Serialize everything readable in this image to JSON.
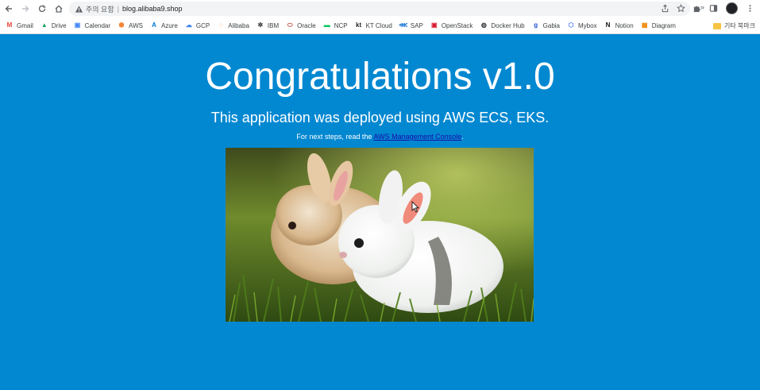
{
  "browser": {
    "security_label": "주의 요함",
    "url": "blog.alibaba9.shop"
  },
  "bookmarks": [
    {
      "label": "Gmail",
      "icon": "gmail-icon",
      "color": "#ea4335",
      "glyph": "M"
    },
    {
      "label": "Drive",
      "icon": "drive-icon",
      "color": "#1fa463",
      "glyph": "▲"
    },
    {
      "label": "Calendar",
      "icon": "calendar-icon",
      "color": "#4285f4",
      "glyph": "▣"
    },
    {
      "label": "AWS",
      "icon": "aws-icon",
      "color": "#f58536",
      "glyph": "⬢"
    },
    {
      "label": "Azure",
      "icon": "azure-icon",
      "color": "#0078d4",
      "glyph": "A"
    },
    {
      "label": "GCP",
      "icon": "gcp-icon",
      "color": "#4285f4",
      "glyph": "☁"
    },
    {
      "label": "Alibaba",
      "icon": "alibaba-icon",
      "color": "#ff6a00",
      "glyph": "◌"
    },
    {
      "label": "IBM",
      "icon": "ibm-icon",
      "color": "#222222",
      "glyph": "✲"
    },
    {
      "label": "Oracle",
      "icon": "oracle-icon",
      "color": "#c74634",
      "glyph": "⬭"
    },
    {
      "label": "NCP",
      "icon": "ncp-icon",
      "color": "#03c75a",
      "glyph": "▬"
    },
    {
      "label": "KT Cloud",
      "icon": "kt-cloud-icon",
      "color": "#222222",
      "glyph": "kt"
    },
    {
      "label": "SAP",
      "icon": "sap-icon",
      "color": "#0a6ed1",
      "glyph": "⋘"
    },
    {
      "label": "OpenStack",
      "icon": "openstack-icon",
      "color": "#da1a32",
      "glyph": "▣"
    },
    {
      "label": "Docker Hub",
      "icon": "docker-icon",
      "color": "#3c4043",
      "glyph": "◍"
    },
    {
      "label": "Gabia",
      "icon": "gabia-icon",
      "color": "#1e4fd8",
      "glyph": "g"
    },
    {
      "label": "Mybox",
      "icon": "mybox-icon",
      "color": "#4f7cff",
      "glyph": "⬡"
    },
    {
      "label": "Notion",
      "icon": "notion-icon",
      "color": "#111111",
      "glyph": "N"
    },
    {
      "label": "Diagram",
      "icon": "diagram-icon",
      "color": "#f08705",
      "glyph": "▦"
    }
  ],
  "bookmarks_more": "»",
  "other_bookmarks": "기타 북마크",
  "page": {
    "title": "Congratulations v1.0",
    "subtitle": "This application was deployed using AWS ECS, EKS.",
    "next_steps_prefix": "For next steps, read the ",
    "next_steps_link": "AWS Management Console",
    "next_steps_suffix": "."
  },
  "colors": {
    "page_background": "#0288d1",
    "link": "#1a0dab"
  }
}
